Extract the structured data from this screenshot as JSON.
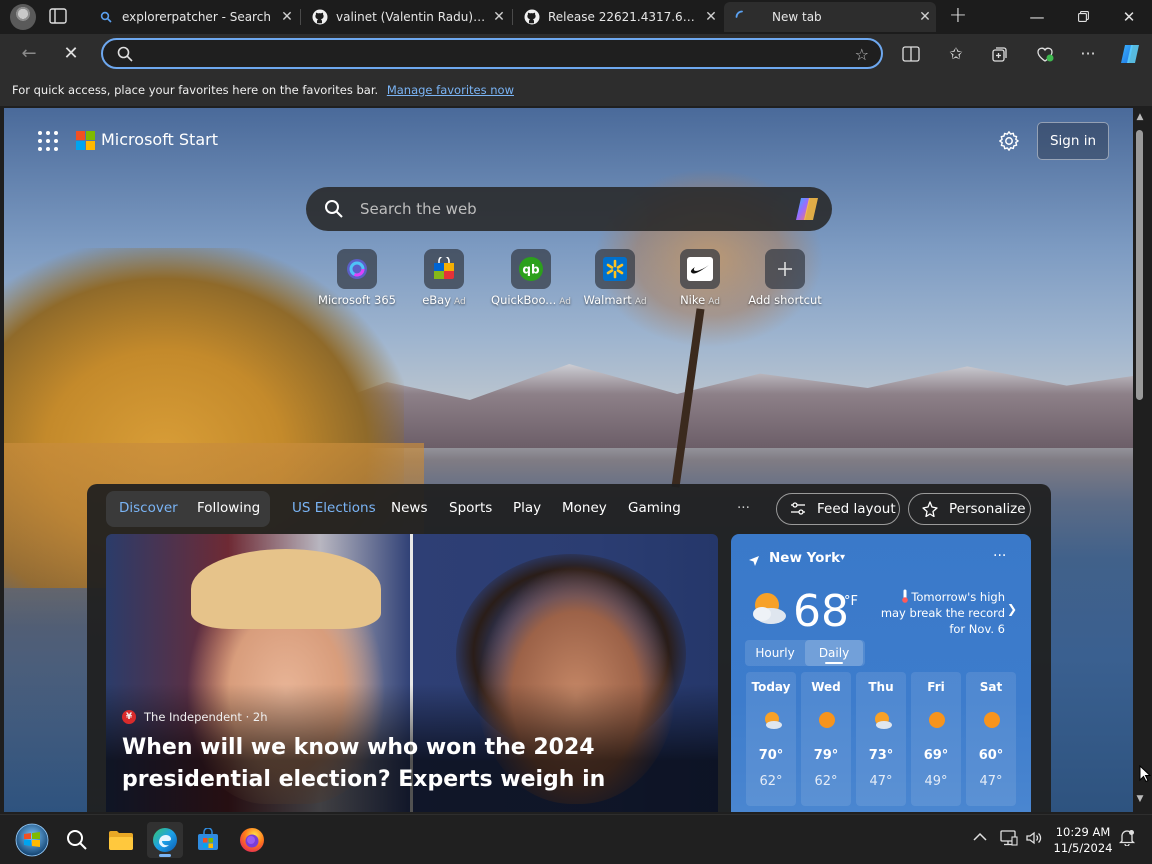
{
  "browser": {
    "tabs": [
      {
        "title": "explorerpatcher - Search",
        "icon": "search-icon"
      },
      {
        "title": "valinet (Valentin Radu) · GitHub",
        "icon": "github-icon"
      },
      {
        "title": "Release 22621.4317.67.1 · valinet",
        "icon": "github-icon"
      },
      {
        "title": "New tab",
        "icon": "loading-icon"
      }
    ],
    "new_tab_symbol": "+",
    "address": {
      "value": "",
      "placeholder": ""
    },
    "favorites_bar": {
      "text": "For quick access, place your favorites here on the favorites bar.",
      "link": "Manage favorites now"
    }
  },
  "start": {
    "brand": "Microsoft Start",
    "sign_in": "Sign in",
    "search_placeholder": "Search the web",
    "shortcuts": [
      {
        "label": "Microsoft 365",
        "ad": ""
      },
      {
        "label": "eBay",
        "ad": "Ad"
      },
      {
        "label": "QuickBoo...",
        "ad": "Ad"
      },
      {
        "label": "Walmart",
        "ad": "Ad"
      },
      {
        "label": "Nike",
        "ad": "Ad"
      },
      {
        "label": "Add shortcut",
        "ad": ""
      }
    ],
    "feed_nav": {
      "discover": "Discover",
      "following": "Following",
      "links": [
        "US Elections",
        "News",
        "Sports",
        "Play",
        "Money",
        "Gaming"
      ],
      "more": "···",
      "feed_layout": "Feed layout",
      "personalize": "Personalize"
    },
    "hero": {
      "source": "The Independent · 2h",
      "headline": "When will we know who won the 2024 presidential election? Experts weigh in"
    },
    "weather": {
      "location": "New York",
      "more": "···",
      "temp": "68",
      "unit": "°F",
      "alert": "Tomorrow's high may break the record for Nov. 6",
      "tabs": [
        "Hourly",
        "Daily"
      ],
      "days": [
        {
          "name": "Today",
          "hi": "70°",
          "lo": "62°",
          "icon": "partly-sunny-icon"
        },
        {
          "name": "Wed",
          "hi": "79°",
          "lo": "62°",
          "icon": "sunny-icon"
        },
        {
          "name": "Thu",
          "hi": "73°",
          "lo": "47°",
          "icon": "partly-sunny-icon"
        },
        {
          "name": "Fri",
          "hi": "69°",
          "lo": "49°",
          "icon": "sunny-icon"
        },
        {
          "name": "Sat",
          "hi": "60°",
          "lo": "47°",
          "icon": "sunny-icon"
        }
      ]
    }
  },
  "taskbar": {
    "time": "10:29 AM",
    "date": "11/5/2024"
  },
  "colors": {
    "accent": "#7ab4f5",
    "address_focus": "#6ea8ef",
    "weather_bg": "#3a79c9"
  }
}
